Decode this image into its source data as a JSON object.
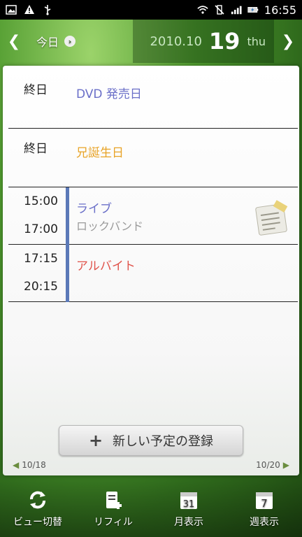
{
  "status_bar": {
    "time": "16:55",
    "left_icons": [
      "photo-icon",
      "warning-icon",
      "usb-icon"
    ],
    "right_icons": [
      "wifi-icon",
      "vibrate-off-icon",
      "signal-icon",
      "battery-charging-icon"
    ]
  },
  "header": {
    "today_label": "今日",
    "year_month": "2010.10",
    "day": "19",
    "weekday": "thu"
  },
  "events": [
    {
      "time_start": "終日",
      "time_end": "",
      "title": "DVD 発売日",
      "subtitle": "",
      "title_color": "#6a6fc8"
    },
    {
      "time_start": "終日",
      "time_end": "",
      "title": "兄誕生日",
      "subtitle": "",
      "title_color": "#e8a326"
    },
    {
      "time_start": "15:00",
      "time_end": "17:00",
      "title": "ライブ",
      "subtitle": "ロックバンド",
      "title_color": "#6a6fc8",
      "has_memo": true
    },
    {
      "time_start": "17:15",
      "time_end": "20:15",
      "title": "アルバイト",
      "subtitle": "",
      "title_color": "#e0534b"
    }
  ],
  "new_event_button": "新しい予定の登録",
  "pager": {
    "prev": "10/18",
    "next": "10/20"
  },
  "toolbar": [
    {
      "label": "ビュー切替",
      "icon": "switch-view-icon"
    },
    {
      "label": "リフィル",
      "icon": "refill-icon"
    },
    {
      "label": "月表示",
      "icon": "month-calendar-icon",
      "icon_text": "31"
    },
    {
      "label": "週表示",
      "icon": "week-calendar-icon",
      "icon_text": "7"
    }
  ]
}
